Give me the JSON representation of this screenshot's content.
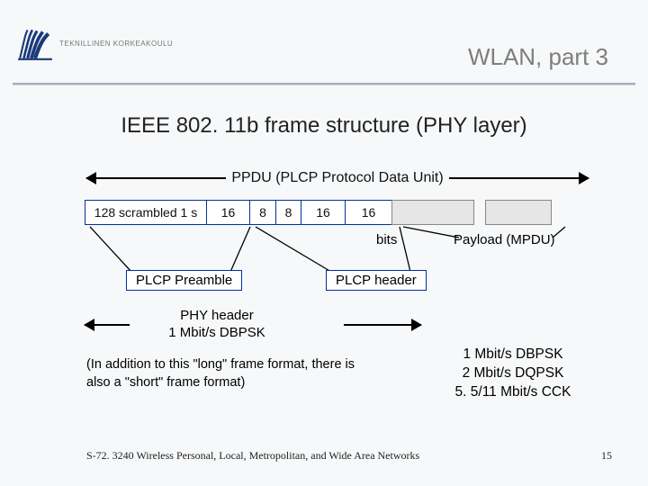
{
  "institution": "Teknillinen Korkeakoulu",
  "header_title": "WLAN, part 3",
  "title": "IEEE 802. 11b frame structure (PHY layer)",
  "ppdu_label": "PPDU (PLCP Protocol Data Unit)",
  "fields": {
    "preamble_sync": "128 scrambled 1 s",
    "sfd": "16",
    "signal": "8",
    "service": "8",
    "length": "16",
    "crc": "16"
  },
  "bits_label": "bits",
  "payload_label": "Payload (MPDU)",
  "sublabels": {
    "preamble": "PLCP Preamble",
    "header": "PLCP header"
  },
  "phy_header": {
    "line1": "PHY header",
    "line2": "1 Mbit/s DBPSK"
  },
  "note": "(In addition to this \"long\" frame format, there is also a \"short\" frame format)",
  "rates": {
    "r1": "1 Mbit/s DBPSK",
    "r2": "2 Mbit/s DQPSK",
    "r3": "5. 5/11 Mbit/s CCK"
  },
  "footer_course": "S-72. 3240 Wireless Personal, Local, Metropolitan, and Wide Area Networks",
  "page_number": "15"
}
